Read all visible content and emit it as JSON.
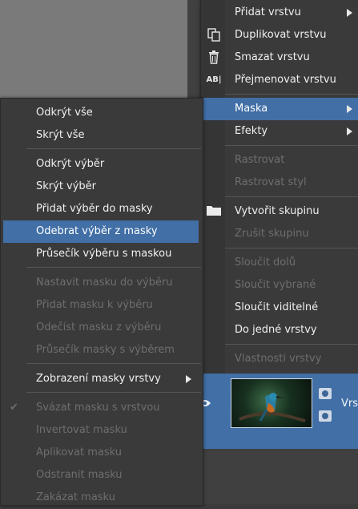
{
  "layer_context_menu": {
    "items": [
      {
        "label": "Přidat vrstvu",
        "icon": "",
        "submenu": true
      },
      {
        "label": "Duplikovat vrstvu",
        "icon": "duplicate-icon"
      },
      {
        "label": "Smazat vrstvu",
        "icon": "trash-icon"
      },
      {
        "label": "Přejmenovat vrstvu",
        "icon": "rename-icon"
      },
      {
        "label": "Maska",
        "submenu": true,
        "highlighted": true
      },
      {
        "label": "Efekty",
        "submenu": true
      },
      {
        "label": "Rastrovat",
        "disabled": true
      },
      {
        "label": "Rastrovat styl",
        "disabled": true
      },
      {
        "label": "Vytvořit skupinu",
        "icon": "folder-icon"
      },
      {
        "label": "Zrušit skupinu",
        "disabled": true
      },
      {
        "label": "Sloučit dolů",
        "disabled": true
      },
      {
        "label": "Sloučit vybrané",
        "disabled": true
      },
      {
        "label": "Sloučit viditelné"
      },
      {
        "label": "Do jedné vrstvy"
      },
      {
        "label": "Vlastnosti vrstvy",
        "disabled": true
      }
    ]
  },
  "mask_submenu": {
    "items": [
      {
        "label": "Odkrýt vše"
      },
      {
        "label": "Skrýt vše"
      },
      {
        "label": "Odkrýt výběr"
      },
      {
        "label": "Skrýt výběr"
      },
      {
        "label": "Přidat výběr do masky"
      },
      {
        "label": "Odebrat výběr z masky",
        "highlighted": true
      },
      {
        "label": "Průsečík výběru s maskou"
      },
      {
        "label": "Nastavit masku do výběru",
        "disabled": true
      },
      {
        "label": "Přidat masku k výběru",
        "disabled": true
      },
      {
        "label": "Odečíst masku z výběru",
        "disabled": true
      },
      {
        "label": "Průsečík masky s výběrem",
        "disabled": true
      },
      {
        "label": "Zobrazení masky vrstvy",
        "submenu": true
      },
      {
        "label": "Svázat masku s vrstvou",
        "disabled": true,
        "checked": true
      },
      {
        "label": "Invertovat masku",
        "disabled": true
      },
      {
        "label": "Aplikovat masku",
        "disabled": true
      },
      {
        "label": "Odstranit masku",
        "disabled": true
      },
      {
        "label": "Zakázat masku",
        "disabled": true
      }
    ]
  },
  "layers_panel": {
    "selected_layer_name": "Vrs",
    "thumbnail": "kingfisher photo"
  },
  "colors": {
    "highlight": "#416fa6",
    "menu_bg": "#3a3a3a",
    "disabled_text": "#6e6e6e"
  }
}
